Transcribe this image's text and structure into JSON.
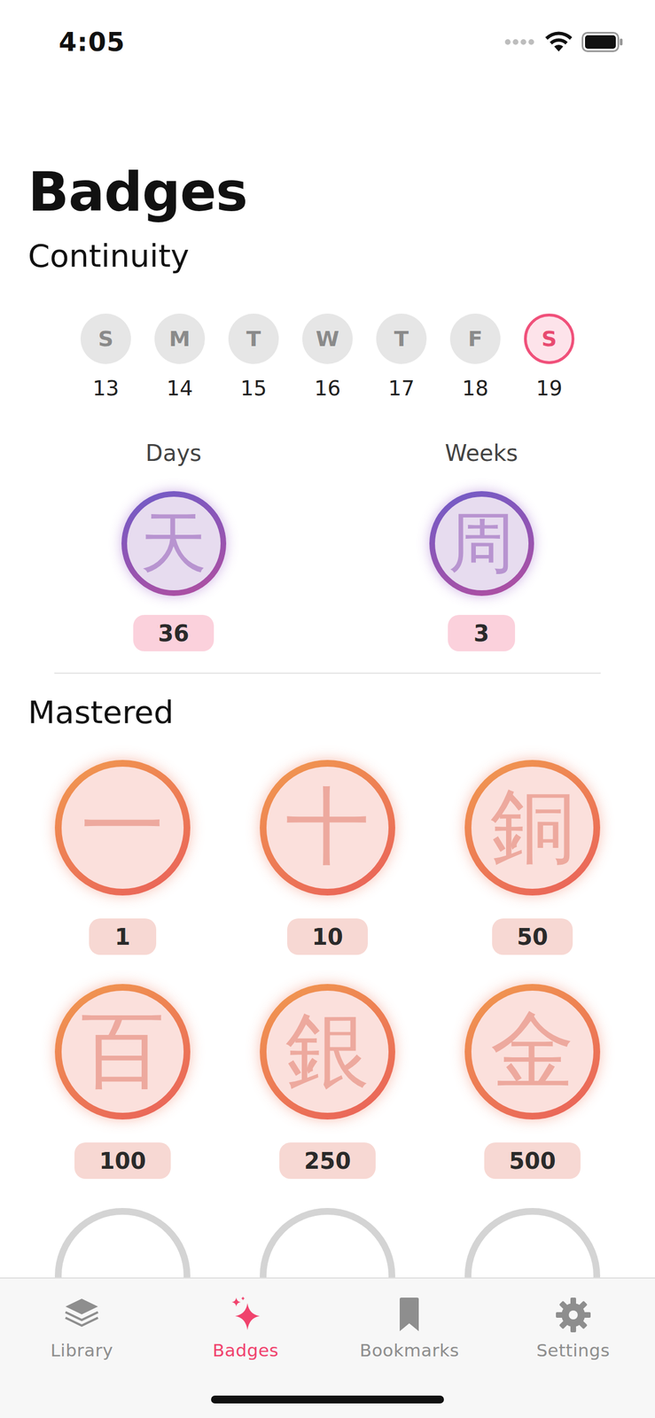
{
  "status_bar": {
    "time": "4:05"
  },
  "title": "Badges",
  "continuity": {
    "heading": "Continuity",
    "week": [
      {
        "letter": "S",
        "date": "13",
        "selected": false
      },
      {
        "letter": "M",
        "date": "14",
        "selected": false
      },
      {
        "letter": "T",
        "date": "15",
        "selected": false
      },
      {
        "letter": "W",
        "date": "16",
        "selected": false
      },
      {
        "letter": "T",
        "date": "17",
        "selected": false
      },
      {
        "letter": "F",
        "date": "18",
        "selected": false
      },
      {
        "letter": "S",
        "date": "19",
        "selected": true
      }
    ],
    "streaks": [
      {
        "label": "Days",
        "kanji": "天",
        "count": "36"
      },
      {
        "label": "Weeks",
        "kanji": "周",
        "count": "3"
      }
    ]
  },
  "mastered": {
    "heading": "Mastered",
    "badges": [
      {
        "kanji": "一",
        "count": "1",
        "earned": true
      },
      {
        "kanji": "十",
        "count": "10",
        "earned": true
      },
      {
        "kanji": "銅",
        "count": "50",
        "earned": true
      },
      {
        "kanji": "百",
        "count": "100",
        "earned": true
      },
      {
        "kanji": "銀",
        "count": "250",
        "earned": true
      },
      {
        "kanji": "金",
        "count": "500",
        "earned": true
      },
      {
        "earned": false
      },
      {
        "earned": false
      },
      {
        "earned": false
      }
    ]
  },
  "tabs": [
    {
      "label": "Library",
      "selected": false
    },
    {
      "label": "Badges",
      "selected": true
    },
    {
      "label": "Bookmarks",
      "selected": false
    },
    {
      "label": "Settings",
      "selected": false
    }
  ]
}
